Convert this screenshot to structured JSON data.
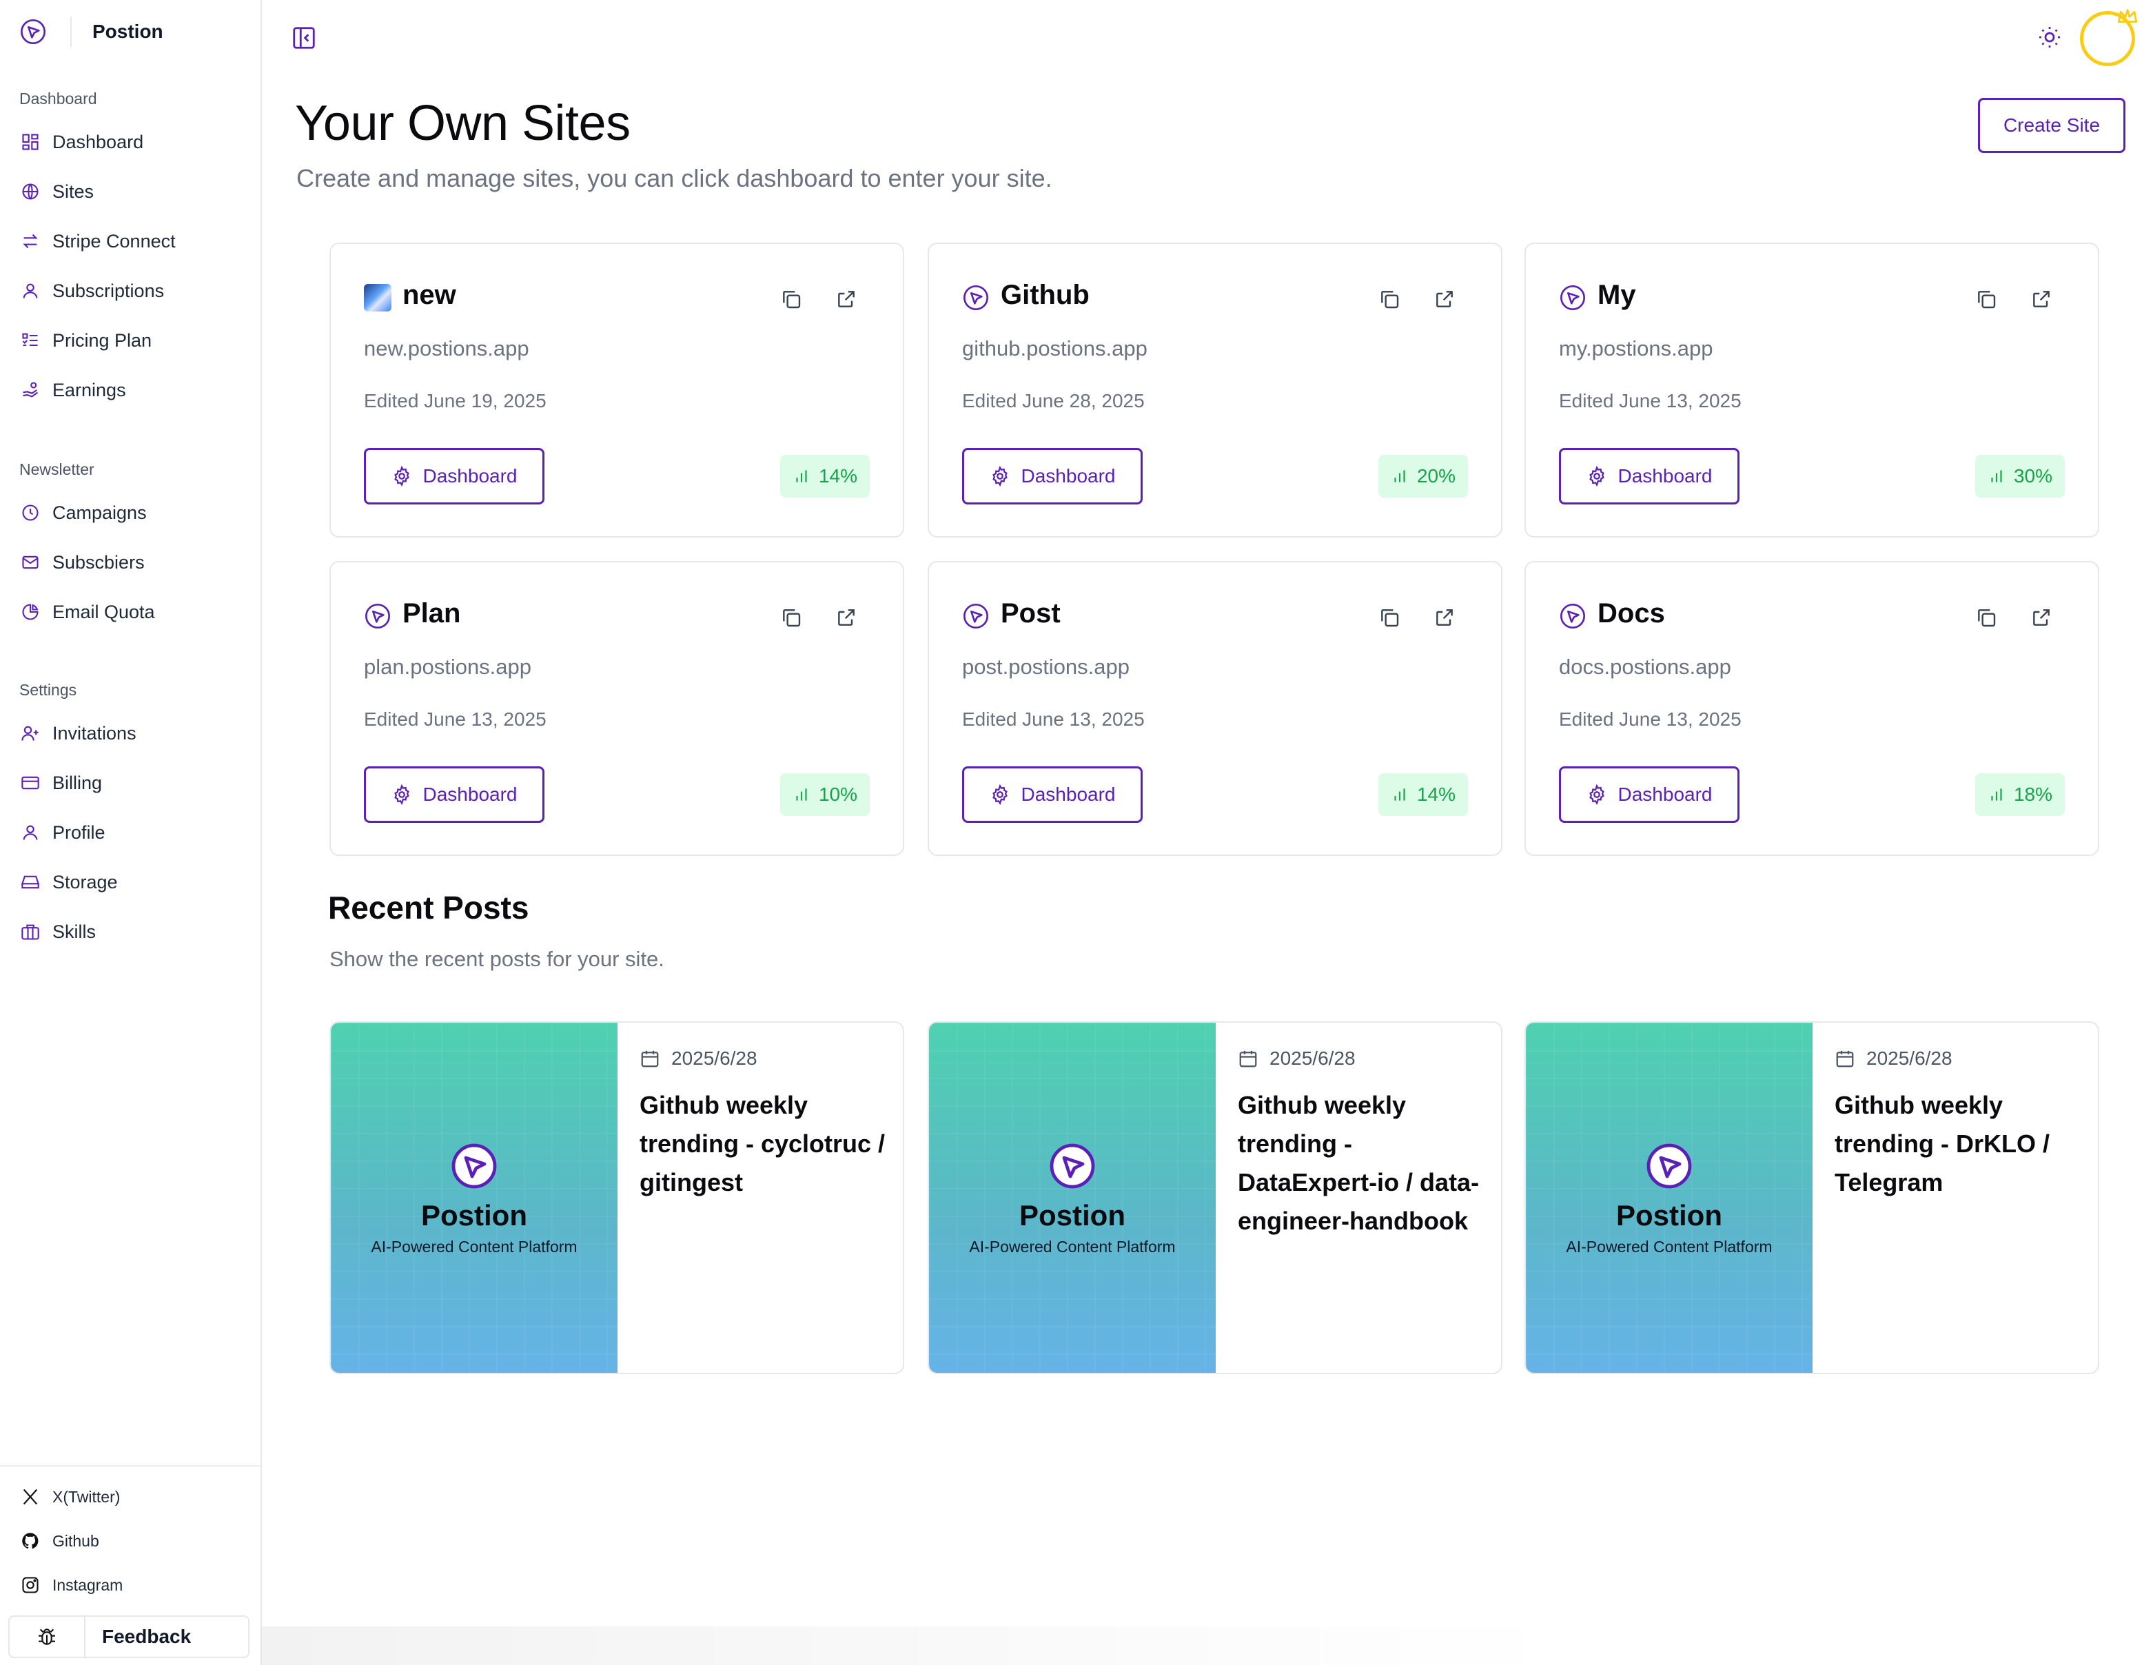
{
  "brand": {
    "name": "Postion"
  },
  "sidebar": {
    "groups": [
      {
        "title": "Dashboard",
        "items": [
          {
            "label": "Dashboard",
            "icon": "layout-grid-icon"
          },
          {
            "label": "Sites",
            "icon": "globe-icon"
          },
          {
            "label": "Stripe Connect",
            "icon": "arrows-exchange-icon"
          },
          {
            "label": "Subscriptions",
            "icon": "user-icon"
          },
          {
            "label": "Pricing Plan",
            "icon": "list-check-icon"
          },
          {
            "label": "Earnings",
            "icon": "hand-coins-icon"
          }
        ]
      },
      {
        "title": "Newsletter",
        "items": [
          {
            "label": "Campaigns",
            "icon": "clock-icon"
          },
          {
            "label": "Subscbiers",
            "icon": "mail-icon"
          },
          {
            "label": "Email Quota",
            "icon": "pie-chart-icon"
          }
        ]
      },
      {
        "title": "Settings",
        "items": [
          {
            "label": "Invitations",
            "icon": "user-plus-icon"
          },
          {
            "label": "Billing",
            "icon": "credit-card-icon"
          },
          {
            "label": "Profile",
            "icon": "user-icon"
          },
          {
            "label": "Storage",
            "icon": "hard-drive-icon"
          },
          {
            "label": "Skills",
            "icon": "briefcase-icon"
          }
        ]
      }
    ],
    "social": [
      {
        "label": "X(Twitter)",
        "icon": "x-icon"
      },
      {
        "label": "Github",
        "icon": "github-icon"
      },
      {
        "label": "Instagram",
        "icon": "instagram-icon"
      }
    ],
    "feedback_label": "Feedback"
  },
  "header": {
    "title": "Your Own Sites",
    "subtitle": "Create and manage sites, you can click dashboard to enter your site.",
    "create_label": "Create Site"
  },
  "sites": [
    {
      "name": "new",
      "domain": "new.postions.app",
      "edited": "Edited June 19, 2025",
      "dashboard_label": "Dashboard",
      "stat": "14%",
      "icon": "image-thumbnail"
    },
    {
      "name": "Github",
      "domain": "github.postions.app",
      "edited": "Edited June 28, 2025",
      "dashboard_label": "Dashboard",
      "stat": "20%",
      "icon": "postion-logo-icon"
    },
    {
      "name": "My",
      "domain": "my.postions.app",
      "edited": "Edited June 13, 2025",
      "dashboard_label": "Dashboard",
      "stat": "30%",
      "icon": "postion-logo-icon"
    },
    {
      "name": "Plan",
      "domain": "plan.postions.app",
      "edited": "Edited June 13, 2025",
      "dashboard_label": "Dashboard",
      "stat": "10%",
      "icon": "postion-logo-icon"
    },
    {
      "name": "Post",
      "domain": "post.postions.app",
      "edited": "Edited June 13, 2025",
      "dashboard_label": "Dashboard",
      "stat": "14%",
      "icon": "postion-logo-icon"
    },
    {
      "name": "Docs",
      "domain": "docs.postions.app",
      "edited": "Edited June 13, 2025",
      "dashboard_label": "Dashboard",
      "stat": "18%",
      "icon": "postion-logo-icon"
    }
  ],
  "recent": {
    "title": "Recent Posts",
    "subtitle": "Show the recent posts for your site.",
    "posts": [
      {
        "date": "2025/6/28",
        "title": "Github weekly trending - cyclotruc / gitingest",
        "cover_name": "Postion",
        "cover_tagline": "AI-Powered Content Platform"
      },
      {
        "date": "2025/6/28",
        "title": "Github weekly trending - DataExpert-io / data-engineer-handbook",
        "cover_name": "Postion",
        "cover_tagline": "AI-Powered Content Platform"
      },
      {
        "date": "2025/6/28",
        "title": "Github weekly trending - DrKLO / Telegram",
        "cover_name": "Postion",
        "cover_tagline": "AI-Powered Content Platform"
      }
    ]
  },
  "colors": {
    "accent": "#5b21b6",
    "stat_bg": "#dcfce7",
    "stat_text": "#16a34a",
    "avatar_ring": "#facc15"
  }
}
